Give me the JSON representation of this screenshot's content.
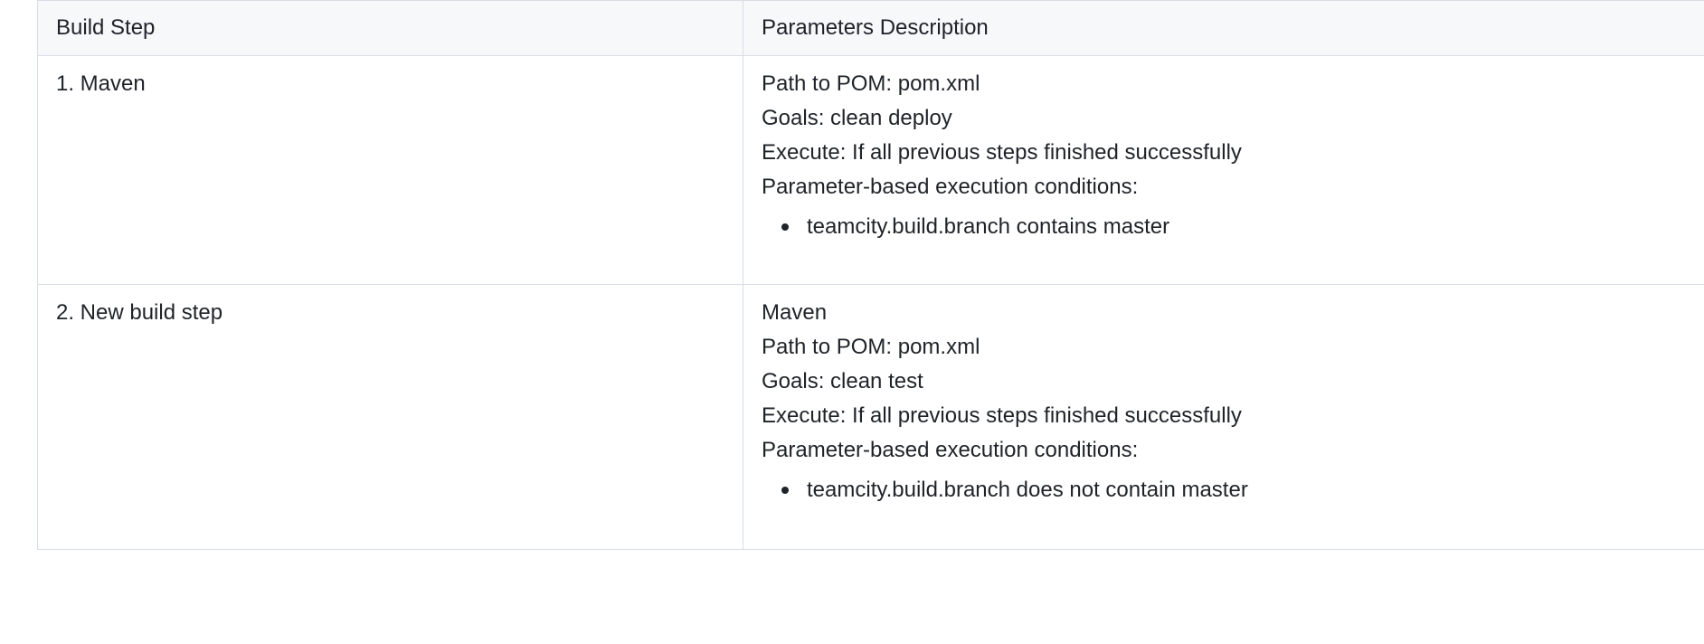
{
  "table": {
    "headers": [
      "Build Step",
      "Parameters Description"
    ],
    "rows": [
      {
        "step": "1. Maven",
        "lines": [
          "Path to POM: pom.xml",
          "Goals: clean deploy",
          "Execute: If all previous steps finished successfully",
          "Parameter-based execution conditions:"
        ],
        "conditions": [
          "teamcity.build.branch contains master"
        ]
      },
      {
        "step": "2. New build step",
        "lines": [
          "Maven",
          "Path to POM: pom.xml",
          "Goals: clean test",
          "Execute: If all previous steps finished successfully",
          "Parameter-based execution conditions:"
        ],
        "conditions": [
          "teamcity.build.branch does not contain master"
        ]
      }
    ]
  }
}
